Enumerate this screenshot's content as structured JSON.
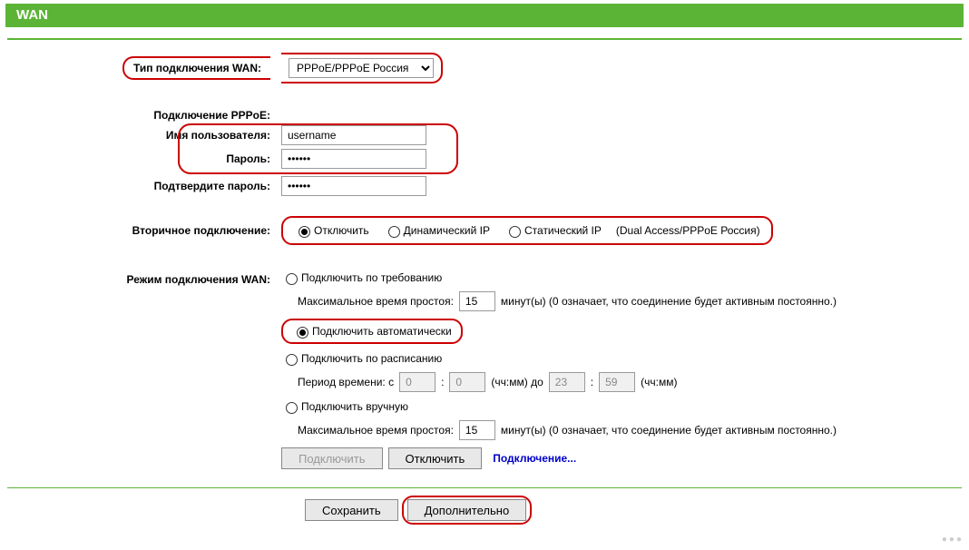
{
  "page": {
    "title": "WAN"
  },
  "wan_type": {
    "label": "Тип подключения WAN:",
    "selected": "PPPoE/PPPoE Россия"
  },
  "pppoe": {
    "section_label": "Подключение PPPoE:",
    "username_label": "Имя пользователя:",
    "password_label": "Пароль:",
    "confirm_password_label": "Подтвердите пароль:",
    "username": "username",
    "password": "••••••",
    "confirm_password": "••••••"
  },
  "secondary": {
    "label": "Вторичное подключение:",
    "opt_disable": "Отключить",
    "opt_dynamic": "Динамический IP",
    "opt_static": "Статический IP",
    "note": "(Dual Access/PPPoE Россия)",
    "selected": "disable"
  },
  "conn_mode": {
    "label": "Режим подключения WAN:",
    "on_demand": "Подключить по требованию",
    "max_idle_label": "Максимальное время простоя:",
    "max_idle_value": "15",
    "max_idle_suffix": "минут(ы) (0 означает, что соединение будет активным постоянно.)",
    "auto": "Подключить автоматически",
    "schedule": "Подключить по расписанию",
    "period_prefix": "Период времени:  с",
    "period_h1": "0",
    "period_m1": "0",
    "period_fmt1": "(чч:мм) до",
    "period_h2": "23",
    "period_m2": "59",
    "period_fmt2": "(чч:мм)",
    "manual": "Подключить вручную",
    "max_idle_value2": "15",
    "btn_connect": "Подключить",
    "btn_disconnect": "Отключить",
    "status": "Подключение...",
    "selected": "auto"
  },
  "footer": {
    "save": "Сохранить",
    "advanced": "Дополнительно"
  }
}
